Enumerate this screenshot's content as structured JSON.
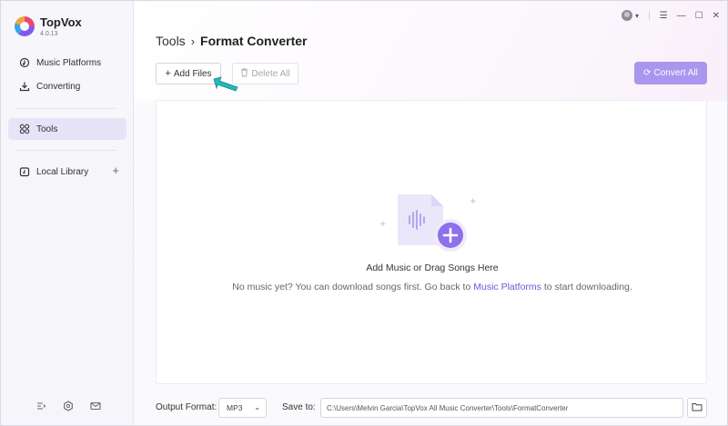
{
  "app": {
    "name": "TopVox",
    "version": "4.0.13"
  },
  "sidebar": {
    "items": [
      {
        "label": "Music Platforms",
        "icon": "music-platforms-icon"
      },
      {
        "label": "Converting",
        "icon": "download-icon"
      },
      {
        "label": "Tools",
        "icon": "tools-grid-icon",
        "active": true
      },
      {
        "label": "Local Library",
        "icon": "library-icon"
      }
    ],
    "bottom_icons": [
      "menu-collapse-icon",
      "settings-hexagon-icon",
      "mail-icon"
    ]
  },
  "header": {
    "breadcrumb_root": "Tools",
    "breadcrumb_sep": "›",
    "breadcrumb_current": "Format Converter"
  },
  "toolbar": {
    "add_files": "Add Files",
    "delete_all": "Delete All",
    "convert_all": "Convert All"
  },
  "dropzone": {
    "title": "Add Music or Drag Songs Here",
    "sub_before": "No music yet? You can download songs first. Go back to ",
    "sub_link": "Music Platforms",
    "sub_after": " to start downloading."
  },
  "footer": {
    "output_format_label": "Output Format:",
    "output_format_value": "MP3",
    "save_to_label": "Save to:",
    "save_to_path": "C:\\Users\\Melvin Garcia\\TopVox All Music Converter\\Tools\\FormatConverter"
  },
  "colors": {
    "accent": "#a996ee",
    "link": "#6e57d8",
    "active_nav_bg": "#e8e4f7",
    "cursor": "#1fb9b9"
  }
}
